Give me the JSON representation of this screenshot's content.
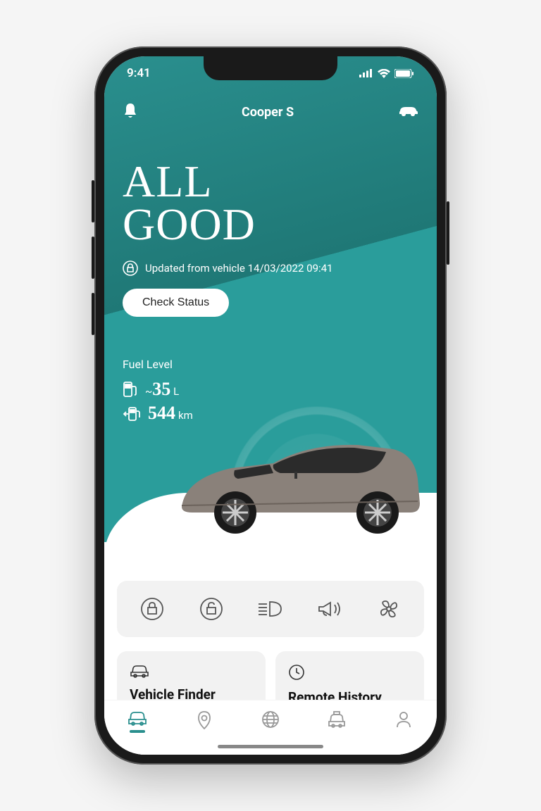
{
  "status_bar": {
    "time": "9:41"
  },
  "header": {
    "title": "Cooper S"
  },
  "hero": {
    "headline_line1": "ALL",
    "headline_line2": "GOOD",
    "update_text": "Updated from vehicle 14/03/2022 09:41",
    "check_button_label": "Check Status"
  },
  "fuel": {
    "title": "Fuel Level",
    "volume_prefix": "~",
    "volume_value": "35",
    "volume_unit": "L",
    "range_value": "544",
    "range_unit": "km"
  },
  "action_icons": [
    "lock",
    "unlock",
    "lights",
    "horn",
    "ventilate"
  ],
  "cards": {
    "vehicle_finder": {
      "title": "Vehicle Finder"
    },
    "remote_history": {
      "title": "Remote History"
    }
  },
  "tabs": [
    "vehicle",
    "map-pin",
    "globe",
    "service",
    "profile"
  ],
  "colors": {
    "teal": "#2a8f8e",
    "icon_gray": "#666"
  }
}
